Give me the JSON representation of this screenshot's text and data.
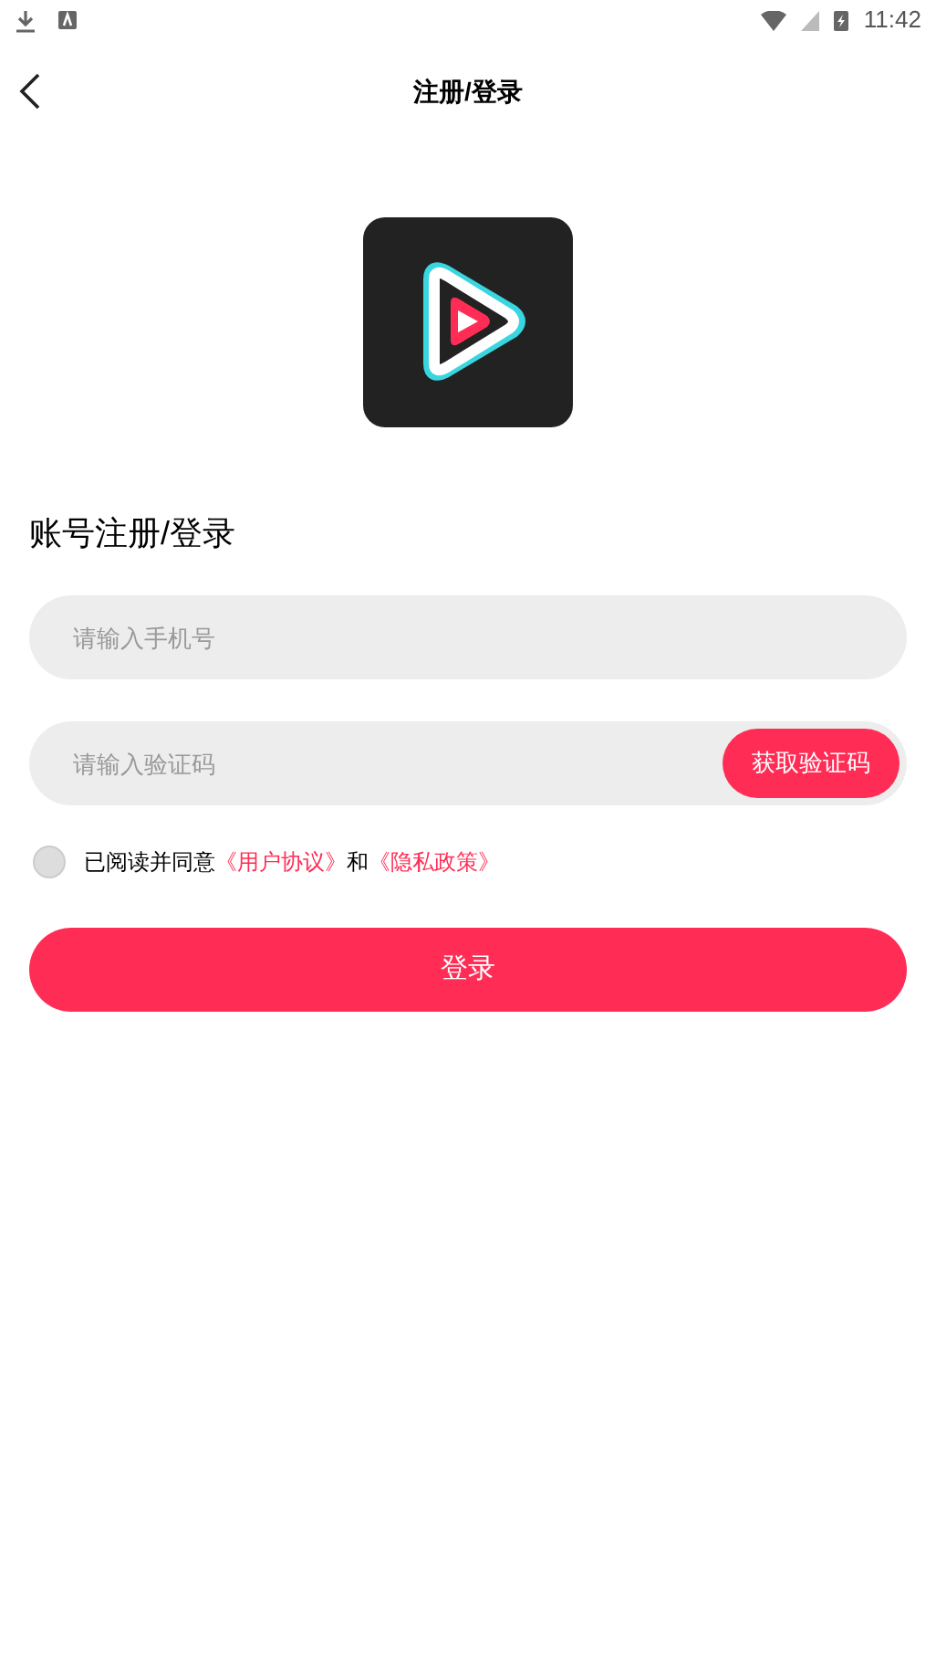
{
  "status_bar": {
    "time": "11:42"
  },
  "header": {
    "title": "注册/登录"
  },
  "heading": "账号注册/登录",
  "phone_field": {
    "placeholder": "请输入手机号"
  },
  "code_field": {
    "placeholder": "请输入验证码",
    "button": "获取验证码"
  },
  "agreement": {
    "checked": false,
    "text": "已阅读并同意",
    "link_1": "《用户协议》",
    "joiner": "和",
    "link_2": "《隐私政策》"
  },
  "login_button": "登录"
}
